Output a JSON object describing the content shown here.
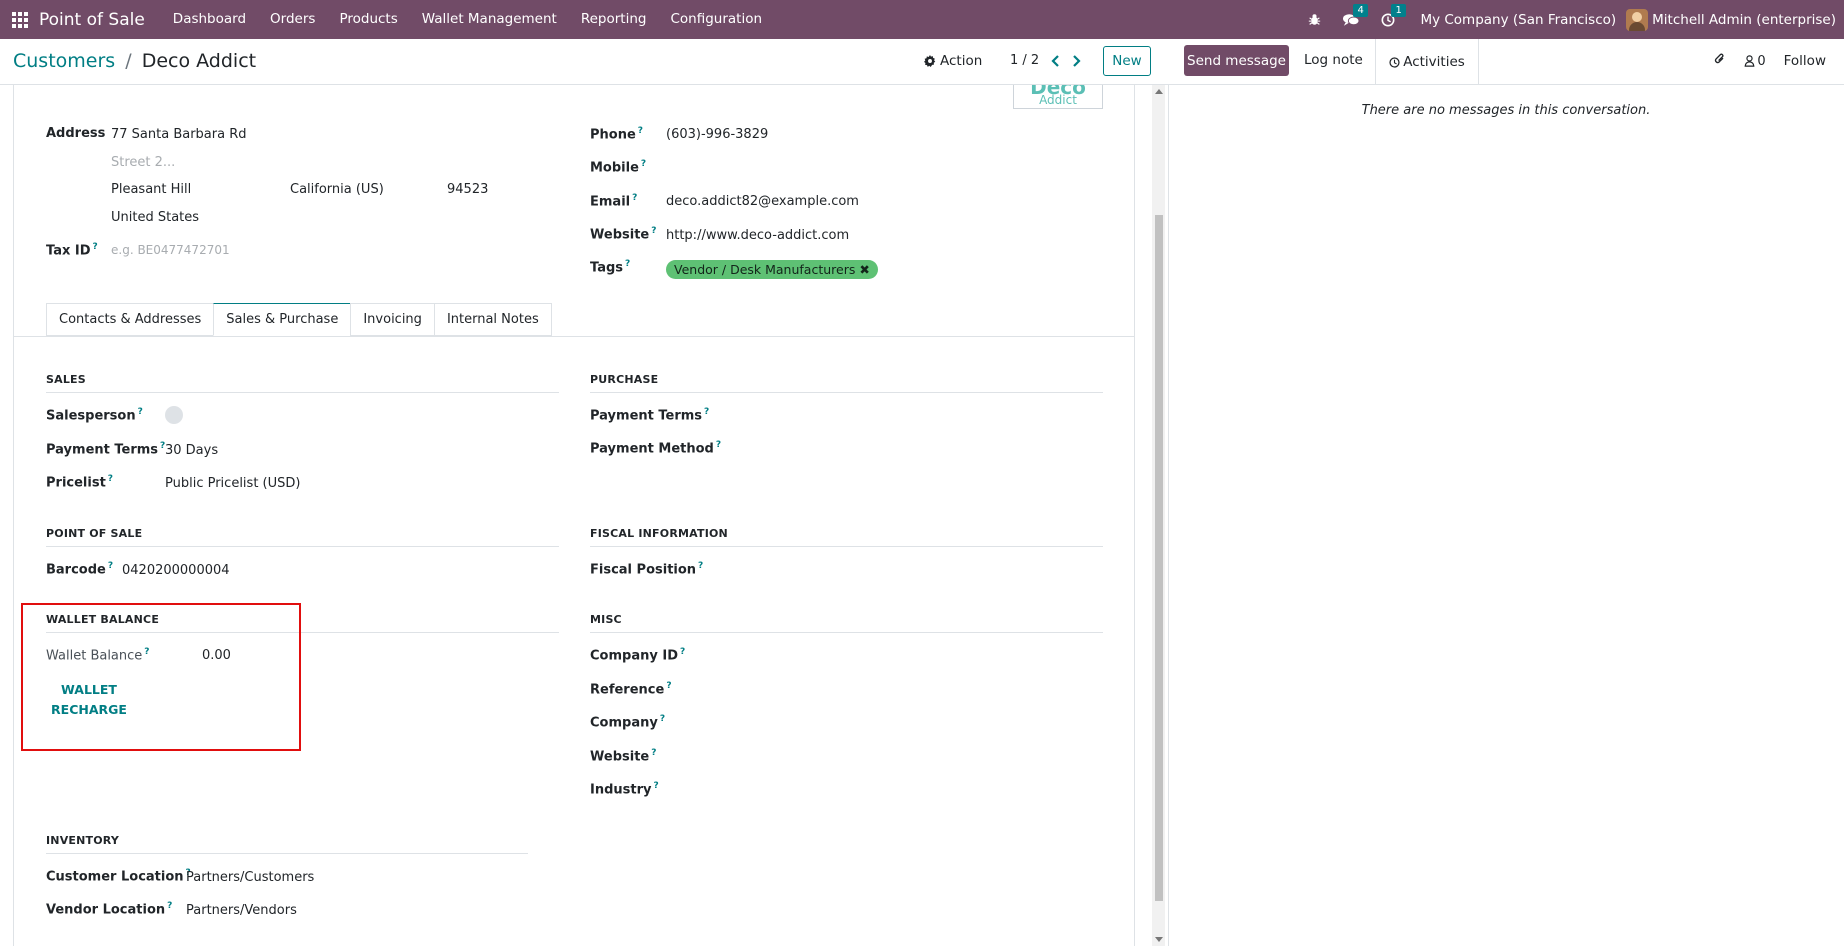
{
  "navbar": {
    "app_name": "Point of Sale",
    "menu": [
      "Dashboard",
      "Orders",
      "Products",
      "Wallet Management",
      "Reporting",
      "Configuration"
    ],
    "messages_badge": "4",
    "activities_badge": "1",
    "company": "My Company (San Francisco)",
    "user": "Mitchell Admin (enterprise)"
  },
  "control": {
    "breadcrumb_parent": "Customers",
    "breadcrumb_sep": "/",
    "breadcrumb_current": "Deco Addict",
    "action_label": "Action",
    "pager": "1 / 2",
    "new_label": "New"
  },
  "chatter": {
    "send_message": "Send message",
    "log_note": "Log note",
    "activities": "Activities",
    "followers_count": "0",
    "follow": "Follow",
    "empty_text": "There are no messages in this conversation."
  },
  "logo": {
    "top": "Deco",
    "bottom": "Addict"
  },
  "address": {
    "label": "Address",
    "street": "77 Santa Barbara Rd",
    "street2_placeholder": "Street 2...",
    "city": "Pleasant Hill",
    "state": "California (US)",
    "zip": "94523",
    "country": "United States"
  },
  "tax_id": {
    "label": "Tax ID",
    "placeholder": "e.g. BE0477472701"
  },
  "contact": {
    "phone_label": "Phone",
    "phone": "(603)-996-3829",
    "mobile_label": "Mobile",
    "email_label": "Email",
    "email": "deco.addict82@example.com",
    "website_label": "Website",
    "website": "http://www.deco-addict.com",
    "tags_label": "Tags",
    "tag": "Vendor / Desk Manufacturers"
  },
  "tabs": [
    "Contacts & Addresses",
    "Sales & Purchase",
    "Invoicing",
    "Internal Notes"
  ],
  "sales": {
    "title": "SALES",
    "salesperson_label": "Salesperson",
    "payment_terms_label": "Payment Terms",
    "payment_terms": "30 Days",
    "pricelist_label": "Pricelist",
    "pricelist": "Public Pricelist (USD)"
  },
  "purchase": {
    "title": "PURCHASE",
    "payment_terms_label": "Payment Terms",
    "payment_method_label": "Payment Method"
  },
  "pos": {
    "title": "POINT OF SALE",
    "barcode_label": "Barcode",
    "barcode": "0420200000004"
  },
  "fiscal": {
    "title": "FISCAL INFORMATION",
    "fiscal_position_label": "Fiscal Position"
  },
  "wallet": {
    "title": "WALLET BALANCE",
    "balance_label": "Wallet Balance",
    "balance": "0.00",
    "recharge_line1": "WALLET",
    "recharge_line2": "RECHARGE"
  },
  "misc": {
    "title": "MISC",
    "company_id_label": "Company ID",
    "reference_label": "Reference",
    "company_label": "Company",
    "website_label": "Website",
    "industry_label": "Industry"
  },
  "inventory": {
    "title": "INVENTORY",
    "customer_location_label": "Customer Location",
    "customer_location": "Partners/Customers",
    "vendor_location_label": "Vendor Location",
    "vendor_location": "Partners/Vendors"
  },
  "colors": {
    "brand": "#714b67",
    "accent": "#017e84",
    "tag": "#5ec174",
    "highlight": "#e10e0e"
  }
}
